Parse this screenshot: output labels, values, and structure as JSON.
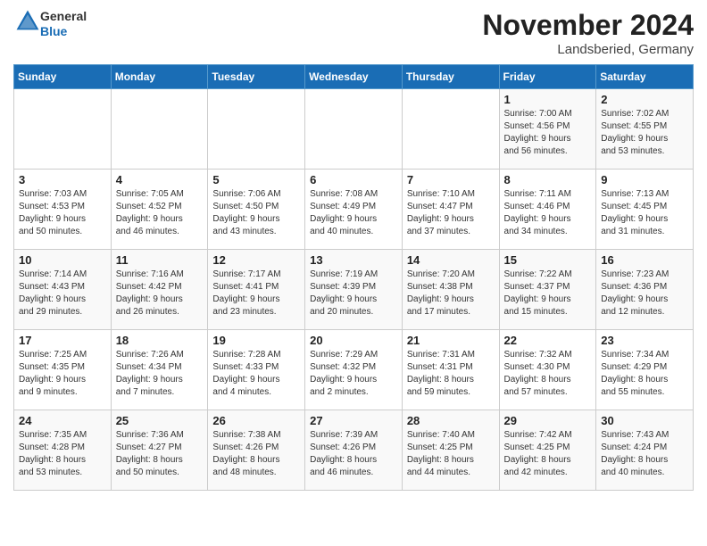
{
  "header": {
    "logo_general": "General",
    "logo_blue": "Blue",
    "month": "November 2024",
    "location": "Landsberied, Germany"
  },
  "weekdays": [
    "Sunday",
    "Monday",
    "Tuesday",
    "Wednesday",
    "Thursday",
    "Friday",
    "Saturday"
  ],
  "weeks": [
    [
      {
        "day": "",
        "info": ""
      },
      {
        "day": "",
        "info": ""
      },
      {
        "day": "",
        "info": ""
      },
      {
        "day": "",
        "info": ""
      },
      {
        "day": "",
        "info": ""
      },
      {
        "day": "1",
        "info": "Sunrise: 7:00 AM\nSunset: 4:56 PM\nDaylight: 9 hours\nand 56 minutes."
      },
      {
        "day": "2",
        "info": "Sunrise: 7:02 AM\nSunset: 4:55 PM\nDaylight: 9 hours\nand 53 minutes."
      }
    ],
    [
      {
        "day": "3",
        "info": "Sunrise: 7:03 AM\nSunset: 4:53 PM\nDaylight: 9 hours\nand 50 minutes."
      },
      {
        "day": "4",
        "info": "Sunrise: 7:05 AM\nSunset: 4:52 PM\nDaylight: 9 hours\nand 46 minutes."
      },
      {
        "day": "5",
        "info": "Sunrise: 7:06 AM\nSunset: 4:50 PM\nDaylight: 9 hours\nand 43 minutes."
      },
      {
        "day": "6",
        "info": "Sunrise: 7:08 AM\nSunset: 4:49 PM\nDaylight: 9 hours\nand 40 minutes."
      },
      {
        "day": "7",
        "info": "Sunrise: 7:10 AM\nSunset: 4:47 PM\nDaylight: 9 hours\nand 37 minutes."
      },
      {
        "day": "8",
        "info": "Sunrise: 7:11 AM\nSunset: 4:46 PM\nDaylight: 9 hours\nand 34 minutes."
      },
      {
        "day": "9",
        "info": "Sunrise: 7:13 AM\nSunset: 4:45 PM\nDaylight: 9 hours\nand 31 minutes."
      }
    ],
    [
      {
        "day": "10",
        "info": "Sunrise: 7:14 AM\nSunset: 4:43 PM\nDaylight: 9 hours\nand 29 minutes."
      },
      {
        "day": "11",
        "info": "Sunrise: 7:16 AM\nSunset: 4:42 PM\nDaylight: 9 hours\nand 26 minutes."
      },
      {
        "day": "12",
        "info": "Sunrise: 7:17 AM\nSunset: 4:41 PM\nDaylight: 9 hours\nand 23 minutes."
      },
      {
        "day": "13",
        "info": "Sunrise: 7:19 AM\nSunset: 4:39 PM\nDaylight: 9 hours\nand 20 minutes."
      },
      {
        "day": "14",
        "info": "Sunrise: 7:20 AM\nSunset: 4:38 PM\nDaylight: 9 hours\nand 17 minutes."
      },
      {
        "day": "15",
        "info": "Sunrise: 7:22 AM\nSunset: 4:37 PM\nDaylight: 9 hours\nand 15 minutes."
      },
      {
        "day": "16",
        "info": "Sunrise: 7:23 AM\nSunset: 4:36 PM\nDaylight: 9 hours\nand 12 minutes."
      }
    ],
    [
      {
        "day": "17",
        "info": "Sunrise: 7:25 AM\nSunset: 4:35 PM\nDaylight: 9 hours\nand 9 minutes."
      },
      {
        "day": "18",
        "info": "Sunrise: 7:26 AM\nSunset: 4:34 PM\nDaylight: 9 hours\nand 7 minutes."
      },
      {
        "day": "19",
        "info": "Sunrise: 7:28 AM\nSunset: 4:33 PM\nDaylight: 9 hours\nand 4 minutes."
      },
      {
        "day": "20",
        "info": "Sunrise: 7:29 AM\nSunset: 4:32 PM\nDaylight: 9 hours\nand 2 minutes."
      },
      {
        "day": "21",
        "info": "Sunrise: 7:31 AM\nSunset: 4:31 PM\nDaylight: 8 hours\nand 59 minutes."
      },
      {
        "day": "22",
        "info": "Sunrise: 7:32 AM\nSunset: 4:30 PM\nDaylight: 8 hours\nand 57 minutes."
      },
      {
        "day": "23",
        "info": "Sunrise: 7:34 AM\nSunset: 4:29 PM\nDaylight: 8 hours\nand 55 minutes."
      }
    ],
    [
      {
        "day": "24",
        "info": "Sunrise: 7:35 AM\nSunset: 4:28 PM\nDaylight: 8 hours\nand 53 minutes."
      },
      {
        "day": "25",
        "info": "Sunrise: 7:36 AM\nSunset: 4:27 PM\nDaylight: 8 hours\nand 50 minutes."
      },
      {
        "day": "26",
        "info": "Sunrise: 7:38 AM\nSunset: 4:26 PM\nDaylight: 8 hours\nand 48 minutes."
      },
      {
        "day": "27",
        "info": "Sunrise: 7:39 AM\nSunset: 4:26 PM\nDaylight: 8 hours\nand 46 minutes."
      },
      {
        "day": "28",
        "info": "Sunrise: 7:40 AM\nSunset: 4:25 PM\nDaylight: 8 hours\nand 44 minutes."
      },
      {
        "day": "29",
        "info": "Sunrise: 7:42 AM\nSunset: 4:25 PM\nDaylight: 8 hours\nand 42 minutes."
      },
      {
        "day": "30",
        "info": "Sunrise: 7:43 AM\nSunset: 4:24 PM\nDaylight: 8 hours\nand 40 minutes."
      }
    ]
  ]
}
